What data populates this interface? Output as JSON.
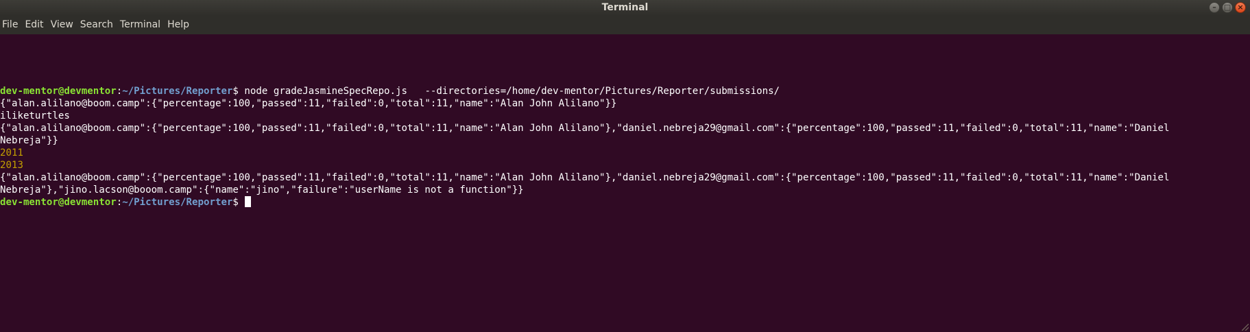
{
  "window": {
    "title": "Terminal",
    "controls": {
      "minimize_icon": "minimize-icon",
      "maximize_icon": "maximize-icon",
      "close_icon": "close-icon"
    }
  },
  "menu": {
    "items": [
      "File",
      "Edit",
      "View",
      "Search",
      "Terminal",
      "Help"
    ]
  },
  "terminal": {
    "prompt": {
      "user_host": "dev-mentor@devmentor",
      "separator": ":",
      "path": "~/Pictures/Reporter",
      "symbol": "$"
    },
    "command": " node gradeJasmineSpecRepo.js   --directories=/home/dev-mentor/Pictures/Reporter/submissions/",
    "output": [
      "{\"alan.alilano@boom.camp\":{\"percentage\":100,\"passed\":11,\"failed\":0,\"total\":11,\"name\":\"Alan John Alilano\"}}",
      "iliketurtles",
      "{\"alan.alilano@boom.camp\":{\"percentage\":100,\"passed\":11,\"failed\":0,\"total\":11,\"name\":\"Alan John Alilano\"},\"daniel.nebreja29@gmail.com\":{\"percentage\":100,\"passed\":11,\"failed\":0,\"total\":11,\"name\":\"Daniel",
      "Nebreja\"}}",
      "2011",
      "2013",
      "{\"alan.alilano@boom.camp\":{\"percentage\":100,\"passed\":11,\"failed\":0,\"total\":11,\"name\":\"Alan John Alilano\"},\"daniel.nebreja29@gmail.com\":{\"percentage\":100,\"passed\":11,\"failed\":0,\"total\":11,\"name\":\"Daniel",
      "Nebreja\"},\"jino.lacson@booom.camp\":{\"name\":\"jino\",\"failure\":\"userName is not a function\"}}"
    ]
  },
  "colors": {
    "background": "#300a24",
    "prompt_user": "#8ae234",
    "prompt_path": "#729fcf",
    "year_output": "#c4a000"
  }
}
